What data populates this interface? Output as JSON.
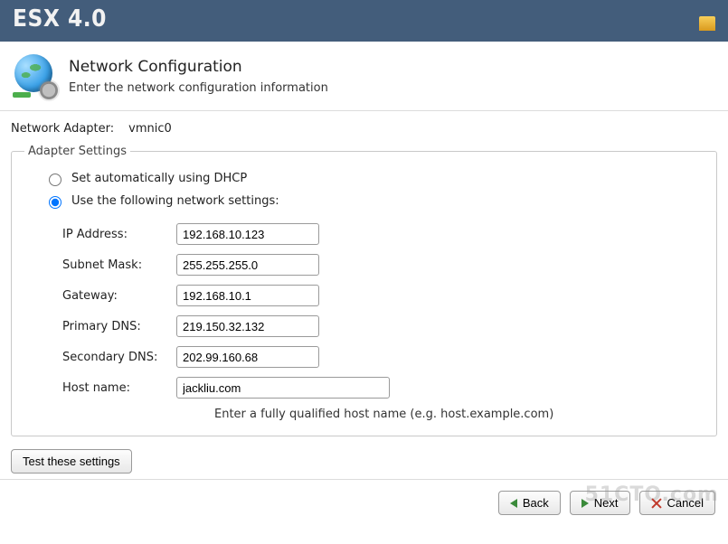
{
  "titlebar": {
    "product": "ESX 4.0"
  },
  "header": {
    "title": "Network Configuration",
    "subtitle": "Enter the network configuration information"
  },
  "adapter": {
    "label": "Network Adapter:",
    "value": "vmnic0"
  },
  "fieldset": {
    "legend": "Adapter Settings",
    "dhcp_label": "Set automatically using DHCP",
    "static_label": "Use the following network settings:",
    "selected": "static"
  },
  "fields": {
    "ip": {
      "label": "IP Address:",
      "value": "192.168.10.123"
    },
    "mask": {
      "label": "Subnet Mask:",
      "value": "255.255.255.0"
    },
    "gw": {
      "label": "Gateway:",
      "value": "192.168.10.1"
    },
    "dns1": {
      "label": "Primary DNS:",
      "value": "219.150.32.132"
    },
    "dns2": {
      "label": "Secondary DNS:",
      "value": "202.99.160.68"
    },
    "host": {
      "label": "Host name:",
      "value": "jackliu.com",
      "hint": "Enter a fully qualified host name (e.g. host.example.com)"
    }
  },
  "buttons": {
    "test": "Test these settings",
    "back": "Back",
    "next": "Next",
    "cancel": "Cancel"
  },
  "watermark": "51CTO.com"
}
